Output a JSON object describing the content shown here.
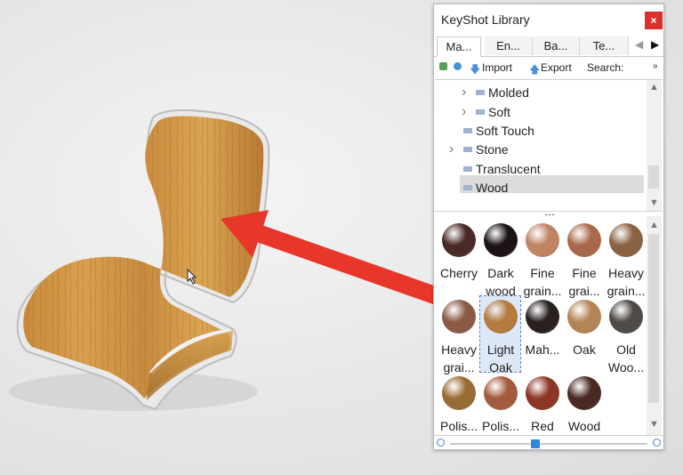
{
  "library": {
    "title": "KeyShot Library",
    "close_label": "×",
    "tabs": [
      "Ma...",
      "En...",
      "Ba...",
      "Te..."
    ],
    "toolbar": {
      "import": "Import",
      "export": "Export",
      "search": "Search:",
      "more": "»"
    },
    "tree": [
      {
        "label": "Molded",
        "expandable": true,
        "folder": true
      },
      {
        "label": "Soft",
        "expandable": true,
        "folder": true
      },
      {
        "label": "Soft Touch",
        "expandable": false,
        "folder": true
      },
      {
        "label": "Stone",
        "expandable": true,
        "folder": true
      },
      {
        "label": "Translucent",
        "expandable": false,
        "folder": true
      },
      {
        "label": "Wood",
        "expandable": false,
        "folder": true,
        "selected": true
      }
    ],
    "materials": [
      {
        "label": "Cherry",
        "color": "#4a2a26"
      },
      {
        "label": "Dark wood",
        "color": "#1c1414"
      },
      {
        "label": "Fine grain...",
        "color": "#c08363"
      },
      {
        "label": "Fine grai...",
        "color": "#a8684b"
      },
      {
        "label": "Heavy grain...",
        "color": "#8a6242"
      },
      {
        "label": "Heavy grai...",
        "color": "#8a5a44"
      },
      {
        "label": "Light Oak",
        "color": "#b57a3e",
        "selected": true
      },
      {
        "label": "Mah...",
        "color": "#2a2020"
      },
      {
        "label": "Oak",
        "color": "#b38456"
      },
      {
        "label": "Old Woo...",
        "color": "#4f4947"
      },
      {
        "label": "Polis...",
        "color": "#9a6c35"
      },
      {
        "label": "Polis...",
        "color": "#a45a3c"
      },
      {
        "label": "Red",
        "color": "#8e3626"
      },
      {
        "label": "Wood",
        "color": "#4a2a22"
      }
    ]
  },
  "accent_colors": {
    "close": "#d9322d",
    "slider": "#2b87d9",
    "arrow": "#e8372a",
    "selection": "#dde8f6"
  }
}
